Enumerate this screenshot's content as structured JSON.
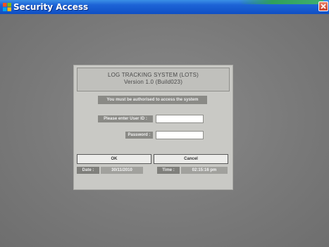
{
  "window": {
    "title": "Security Access",
    "app_icon": "windows-logo-icon",
    "close_icon": "close-icon",
    "titlebar_color": "#1d63d6",
    "close_color": "#c9422a"
  },
  "login": {
    "header_line1": "LOG TRACKING SYSTEM (LOTS)",
    "header_line2": "Version 1.0 (Build023)",
    "auth_message": "You must be authorised to access the system",
    "userid_label": "Please enter User ID :",
    "userid_value": "",
    "password_label": "Password :",
    "password_value": "",
    "ok_label": "OK",
    "cancel_label": "Cancel",
    "date_label": "Date :",
    "date_value": "30/11/2010",
    "time_label": "Time :",
    "time_value": "02:15:16 pm"
  },
  "colors": {
    "background": "#7b7b7b",
    "panel": "#c9c9c5",
    "label_bg": "#8a8a86"
  }
}
